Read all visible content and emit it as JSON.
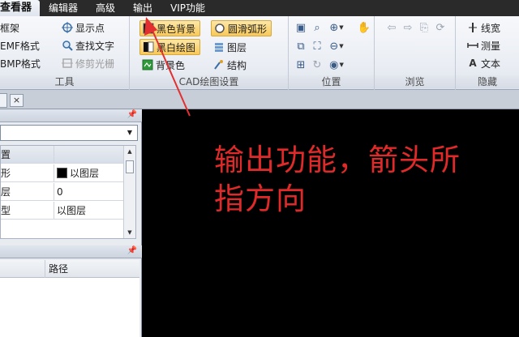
{
  "menubar": {
    "tabs": [
      {
        "label": "查看器"
      },
      {
        "label": "编辑器"
      },
      {
        "label": "高级"
      },
      {
        "label": "输出"
      },
      {
        "label": "VIP功能"
      }
    ]
  },
  "ribbon": {
    "tools": {
      "title": "工具",
      "frame": "框架",
      "emf": "EMF格式",
      "bmp": "BMP格式",
      "show_points": "显示点",
      "find_text": "查找文字",
      "trim_raster": "修剪光栅"
    },
    "cad": {
      "title": "CAD绘图设置",
      "black_bg": "黑色背景",
      "bw_drawing": "黑白绘图",
      "bg_color": "背景色",
      "smooth_arc": "圆滑弧形",
      "layers": "图层",
      "structure": "结构"
    },
    "position": {
      "title": "位置"
    },
    "browse": {
      "title": "浏览"
    },
    "hide": {
      "title": "隐藏",
      "line_width": "线宽",
      "measure": "测量",
      "text": "文本"
    }
  },
  "doc_tab": {
    "close": "×"
  },
  "properties": {
    "rows": [
      {
        "name": "置",
        "value": ""
      },
      {
        "name": "形",
        "value": "以图层"
      },
      {
        "name": "层",
        "value": "0"
      },
      {
        "name": "型",
        "value": "以图层"
      }
    ]
  },
  "file_list": {
    "col_path": "路径"
  },
  "canvas": {
    "annotation_line1": "输出功能，箭头所",
    "annotation_line2": "指方向"
  },
  "colors": {
    "annotation": "#e02a2a",
    "arrow": "#e23030",
    "menubar": "#2a2a2a",
    "highlight": "#f8c859"
  }
}
